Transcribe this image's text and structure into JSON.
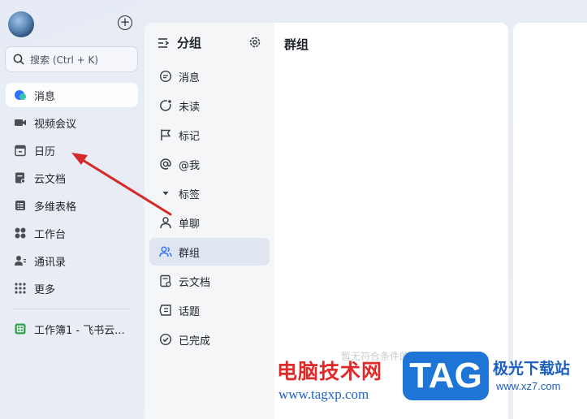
{
  "sidebar": {
    "search_label": "搜索 (Ctrl + K)",
    "items": [
      {
        "label": "消息",
        "icon": "message-icon",
        "active": true
      },
      {
        "label": "视频会议",
        "icon": "video-icon"
      },
      {
        "label": "日历",
        "icon": "calendar-icon"
      },
      {
        "label": "云文档",
        "icon": "doc-icon"
      },
      {
        "label": "多维表格",
        "icon": "table-icon"
      },
      {
        "label": "工作台",
        "icon": "apps-icon"
      },
      {
        "label": "通讯录",
        "icon": "contacts-icon"
      },
      {
        "label": "更多",
        "icon": "more-icon"
      }
    ],
    "pinned": {
      "label": "工作簿1 - 飞书云...",
      "icon": "sheet-icon"
    }
  },
  "group_panel": {
    "title": "分组",
    "items": [
      {
        "label": "消息",
        "icon": "chat-bubble-icon"
      },
      {
        "label": "未读",
        "icon": "unread-icon"
      },
      {
        "label": "标记",
        "icon": "flag-icon"
      },
      {
        "label": "@我",
        "icon": "at-icon"
      },
      {
        "label": "标签",
        "icon": "caret-down-icon"
      },
      {
        "label": "单聊",
        "icon": "person-icon"
      },
      {
        "label": "群组",
        "icon": "group-icon",
        "active": true
      },
      {
        "label": "云文档",
        "icon": "doc-icon"
      },
      {
        "label": "话题",
        "icon": "topic-icon"
      },
      {
        "label": "已完成",
        "icon": "check-circle-icon"
      }
    ]
  },
  "chat": {
    "title": "群组",
    "empty_hint": "暂无符合条件的会话"
  },
  "watermark": {
    "cn": "电脑技术网",
    "url": "www.tagxp.com",
    "tag": "TAG",
    "site_cn": "极光下载站",
    "site_url": "www.xz7.com"
  },
  "colors": {
    "accent": "#3370ff",
    "arrow": "#d42a2a",
    "active_group_bg": "#dfe6f2"
  }
}
